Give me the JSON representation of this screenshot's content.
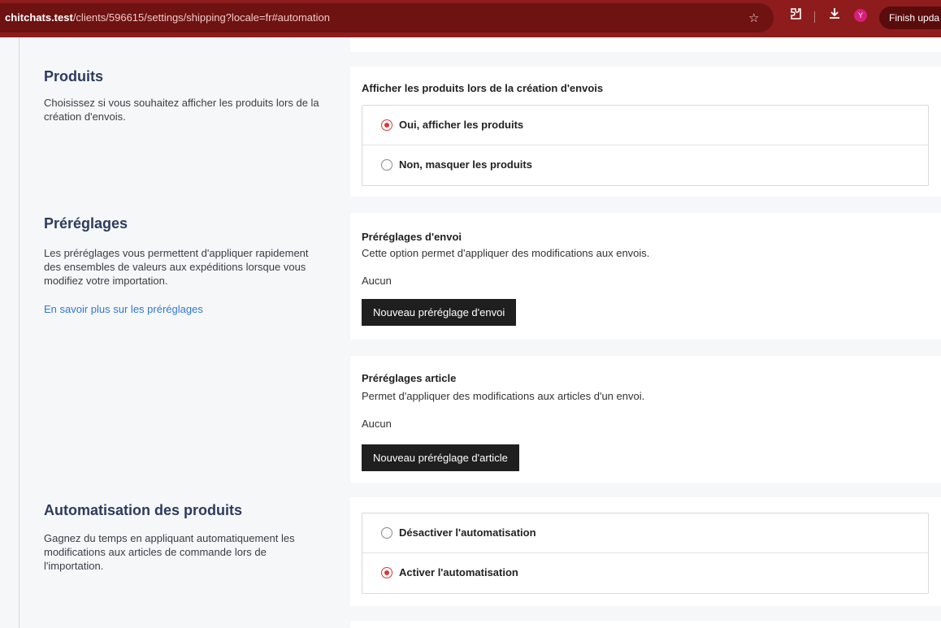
{
  "browser": {
    "url_host": "chitchats.test",
    "url_path": "/clients/596615/settings/shipping?locale=fr#automation",
    "star_icon": "☆",
    "extensions_icon": "⧉",
    "download_icon": "⤓",
    "avatar_letter": "Y",
    "finish_update_label": "Finish upda",
    "colors": {
      "bar": "#8e1c1c",
      "avatar": "#d61f7a"
    }
  },
  "sections": {
    "produits": {
      "title": "Produits",
      "description": "Choisissez si vous souhaitez afficher les produits lors de la création d'envois.",
      "card_heading": "Afficher les produits lors de la création d'envois",
      "options": [
        {
          "label": "Oui, afficher les produits",
          "checked": true
        },
        {
          "label": "Non, masquer les produits",
          "checked": false
        }
      ]
    },
    "preglages": {
      "title": "Préréglages",
      "description": "Les préréglages vous permettent d'appliquer rapidement des ensembles de valeurs aux expéditions lorsque vous modifiez votre importation.",
      "link": "En savoir plus sur les préréglages",
      "envoi": {
        "heading": "Préréglages d'envoi",
        "description": "Cette option permet d'appliquer des modifications aux envois.",
        "value": "Aucun",
        "button": "Nouveau préréglage d'envoi"
      },
      "article": {
        "heading": "Préréglages article",
        "description": "Permet d'appliquer des modifications aux articles d'un envoi.",
        "value": "Aucun",
        "button": "Nouveau préréglage d'article"
      }
    },
    "automatisation": {
      "title": "Automatisation des produits",
      "description": "Gagnez du temps en appliquant automatiquement les modifications aux articles de commande lors de l'importation.",
      "options": [
        {
          "label": "Désactiver l'automatisation",
          "checked": false
        },
        {
          "label": "Activer l'automatisation",
          "checked": true
        }
      ]
    }
  },
  "colors": {
    "accent_radio": "#d93939",
    "title": "#2b3c5e",
    "link": "#2f78d6",
    "button": "#1f1f1f"
  }
}
